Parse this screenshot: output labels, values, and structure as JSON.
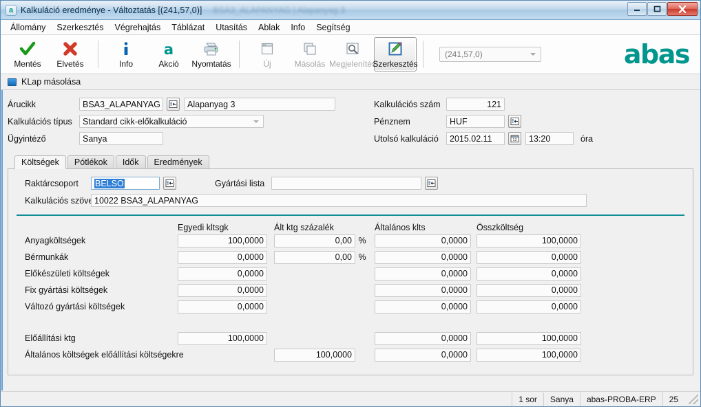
{
  "window": {
    "title": "Kalkuláció eredménye - Változtatás  [(241,57,0)]",
    "ghost_title": "BSA3_ALAPANYAG | Alapanyag 3",
    "app_icon": "abas-app-icon",
    "minimize": "–",
    "maximize": "❐",
    "close": "✕"
  },
  "menubar": {
    "items": [
      {
        "label": "Állomány"
      },
      {
        "label": "Szerkesztés"
      },
      {
        "label": "Végrehajtás"
      },
      {
        "label": "Táblázat"
      },
      {
        "label": "Utasítás"
      },
      {
        "label": "Ablak"
      },
      {
        "label": "Info"
      },
      {
        "label": "Segítség"
      }
    ]
  },
  "toolbar": {
    "buttons": [
      {
        "label": "Mentés",
        "icon": "check-icon",
        "enabled": true,
        "selected": false
      },
      {
        "label": "Elvetés",
        "icon": "cross-icon",
        "enabled": true,
        "selected": false
      },
      {
        "label": "Info",
        "icon": "info-icon",
        "enabled": true,
        "selected": false
      },
      {
        "label": "Akció",
        "icon": "action-a-icon",
        "enabled": true,
        "selected": false
      },
      {
        "label": "Nyomtatás",
        "icon": "printer-icon",
        "enabled": true,
        "selected": false
      },
      {
        "label": "Új",
        "icon": "new-doc-icon",
        "enabled": false,
        "selected": false
      },
      {
        "label": "Másolás",
        "icon": "copy-icon",
        "enabled": false,
        "selected": false
      },
      {
        "label": "Megjelenítés",
        "icon": "magnifier-icon",
        "enabled": false,
        "selected": false
      },
      {
        "label": "Szerkesztés",
        "icon": "edit-pencil-icon",
        "enabled": true,
        "selected": true
      }
    ],
    "combo_value": "(241,57,0)",
    "logo": "abas",
    "logo_color": "#00968e"
  },
  "subheader": {
    "label": "KLap másolása",
    "icon": "blue-square-icon"
  },
  "form": {
    "left": {
      "arucikk_label": "Árucikk",
      "arucikk_value": "BSA3_ALAPANYAG",
      "arucikk_desc": "Alapanyag 3",
      "tipus_label": "Kalkulációs típus",
      "tipus_value": "Standard cikk-előkalkuláció",
      "ugyintezo_label": "Ügyintéző",
      "ugyintezo_value": "Sanya"
    },
    "right": {
      "kalkszam_label": "Kalkulációs szám",
      "kalkszam_value": "121",
      "penznem_label": "Pénznem",
      "penznem_value": "HUF",
      "utolso_label": "Utolsó kalkuláció",
      "utolso_date": "2015.02.11",
      "utolso_time": "13:20",
      "utolso_unit": "óra"
    }
  },
  "tabs": [
    {
      "label": "Költségek",
      "active": true
    },
    {
      "label": "Pótlékok",
      "active": false
    },
    {
      "label": "Idők",
      "active": false
    },
    {
      "label": "Eredmények",
      "active": false
    }
  ],
  "tabpane": {
    "raktarcsoport_label": "Raktárcsoport",
    "raktarcsoport_value": "BELSO",
    "gyartasi_label": "Gyártási lista",
    "gyartasi_value": "",
    "szoveg_label": "Kalkulációs szöveg",
    "szoveg_value": "10022 BSA3_ALAPANYAG"
  },
  "costs": {
    "headers": [
      "",
      "Egyedi kltsgk",
      "Ált ktg százalék",
      "",
      "Általános klts",
      "Összköltség"
    ],
    "percent_sign": "%",
    "rows": [
      {
        "label": "Anyagköltségek",
        "egyedi": "100,0000",
        "pct": "0,00",
        "has_pct": true,
        "altalanos": "0,0000",
        "ossz": "100,0000"
      },
      {
        "label": "Bérmunkák",
        "egyedi": "0,0000",
        "pct": "0,00",
        "has_pct": true,
        "altalanos": "0,0000",
        "ossz": "0,0000"
      },
      {
        "label": "Előkészületi költségek",
        "egyedi": "0,0000",
        "pct": "",
        "has_pct": false,
        "altalanos": "0,0000",
        "ossz": "0,0000"
      },
      {
        "label": "Fix gyártási költségek",
        "egyedi": "0,0000",
        "pct": "",
        "has_pct": false,
        "altalanos": "0,0000",
        "ossz": "0,0000"
      },
      {
        "label": "Változó gyártási költségek",
        "egyedi": "0,0000",
        "pct": "",
        "has_pct": false,
        "altalanos": "0,0000",
        "ossz": "0,0000"
      }
    ],
    "summary": [
      {
        "label": "Előállítási ktg",
        "egyedi": "100,0000",
        "pct": "",
        "has_pct": false,
        "altalanos": "0,0000",
        "ossz": "100,0000"
      },
      {
        "label": "Általános költségek előállítási költségekre",
        "egyedi": "",
        "pct": "100,0000",
        "has_pct": true,
        "altalanos": "0,0000",
        "ossz": "100,0000"
      }
    ]
  },
  "statusbar": {
    "cells": [
      "1 sor",
      "Sanya",
      "abas-PROBA-ERP",
      "25"
    ]
  }
}
